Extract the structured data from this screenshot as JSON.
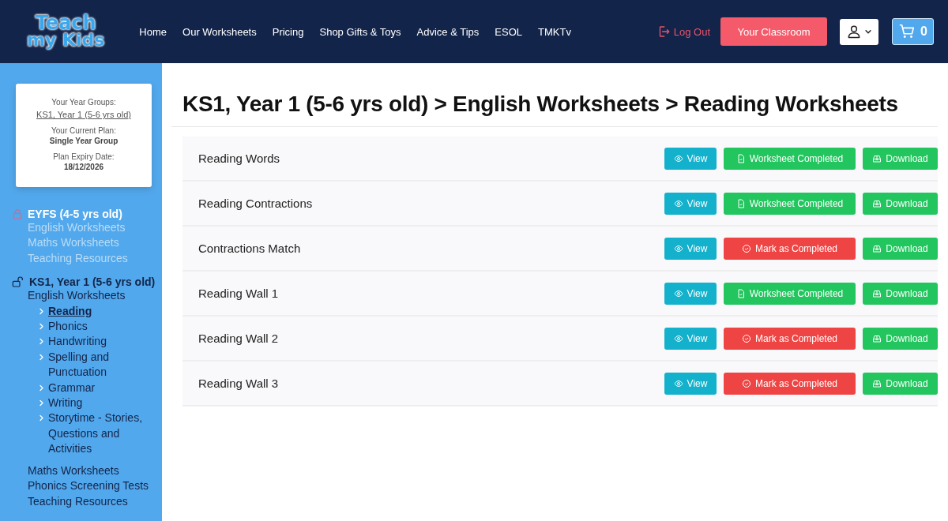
{
  "header": {
    "logo": [
      "Teach",
      "my Kids"
    ],
    "nav": [
      "Home",
      "Our Worksheets",
      "Pricing",
      "Shop Gifts & Toys",
      "Advice & Tips",
      "ESOL",
      "TMKTv"
    ],
    "logout": "Log Out",
    "classroom_button": "Your Classroom",
    "cart_count": "0"
  },
  "account_card": [
    {
      "kind": "label",
      "text": "Your Year Groups:"
    },
    {
      "kind": "link",
      "text": "KS1, Year 1 (5-6 yrs old)"
    },
    {
      "kind": "label",
      "text": "Your Current Plan:"
    },
    {
      "kind": "value",
      "text": "Single Year Group"
    },
    {
      "kind": "label",
      "text": "Plan Expiry Date:"
    },
    {
      "kind": "value",
      "text": "18/12/2026"
    }
  ],
  "sidebar": {
    "groups": [
      {
        "title": "EYFS (4-5 yrs old)",
        "locked": true,
        "children": [
          {
            "label": "English Worksheets",
            "selected": false
          },
          {
            "label": "Maths Worksheets",
            "selected": false
          },
          {
            "label": "Teaching Resources",
            "selected": false
          }
        ]
      },
      {
        "title": "KS1, Year 1 (5-6 yrs old)",
        "locked": false,
        "children": [
          {
            "label": "English Worksheets",
            "selected": false,
            "children": [
              {
                "label": "Reading",
                "selected": true
              },
              {
                "label": "Phonics",
                "selected": false
              },
              {
                "label": "Handwriting",
                "selected": false
              },
              {
                "label": "Spelling and Punctuation",
                "selected": false
              },
              {
                "label": "Grammar",
                "selected": false
              },
              {
                "label": "Writing",
                "selected": false
              },
              {
                "label": "Storytime - Stories, Questions and Activities",
                "selected": false
              }
            ]
          },
          {
            "label": "Maths Worksheets",
            "selected": false
          },
          {
            "label": "Phonics Screening Tests",
            "selected": false
          },
          {
            "label": "Teaching Resources",
            "selected": false
          }
        ]
      }
    ]
  },
  "page_title": "KS1, Year 1 (5-6 yrs old) > English Worksheets > Reading Worksheets",
  "worksheets": [
    {
      "title": "Reading Words",
      "view": "View",
      "completed": true,
      "status": "Worksheet Completed",
      "download": "Download"
    },
    {
      "title": "Reading Contractions",
      "view": "View",
      "completed": true,
      "status": "Worksheet Completed",
      "download": "Download"
    },
    {
      "title": "Contractions Match",
      "view": "View",
      "completed": false,
      "status": "Mark as Completed",
      "download": "Download"
    },
    {
      "title": "Reading Wall 1",
      "view": "View",
      "completed": true,
      "status": "Worksheet Completed",
      "download": "Download"
    },
    {
      "title": "Reading Wall 2",
      "view": "View",
      "completed": false,
      "status": "Mark as Completed",
      "download": "Download"
    },
    {
      "title": "Reading Wall 3",
      "view": "View",
      "completed": false,
      "status": "Mark as Completed",
      "download": "Download"
    }
  ]
}
